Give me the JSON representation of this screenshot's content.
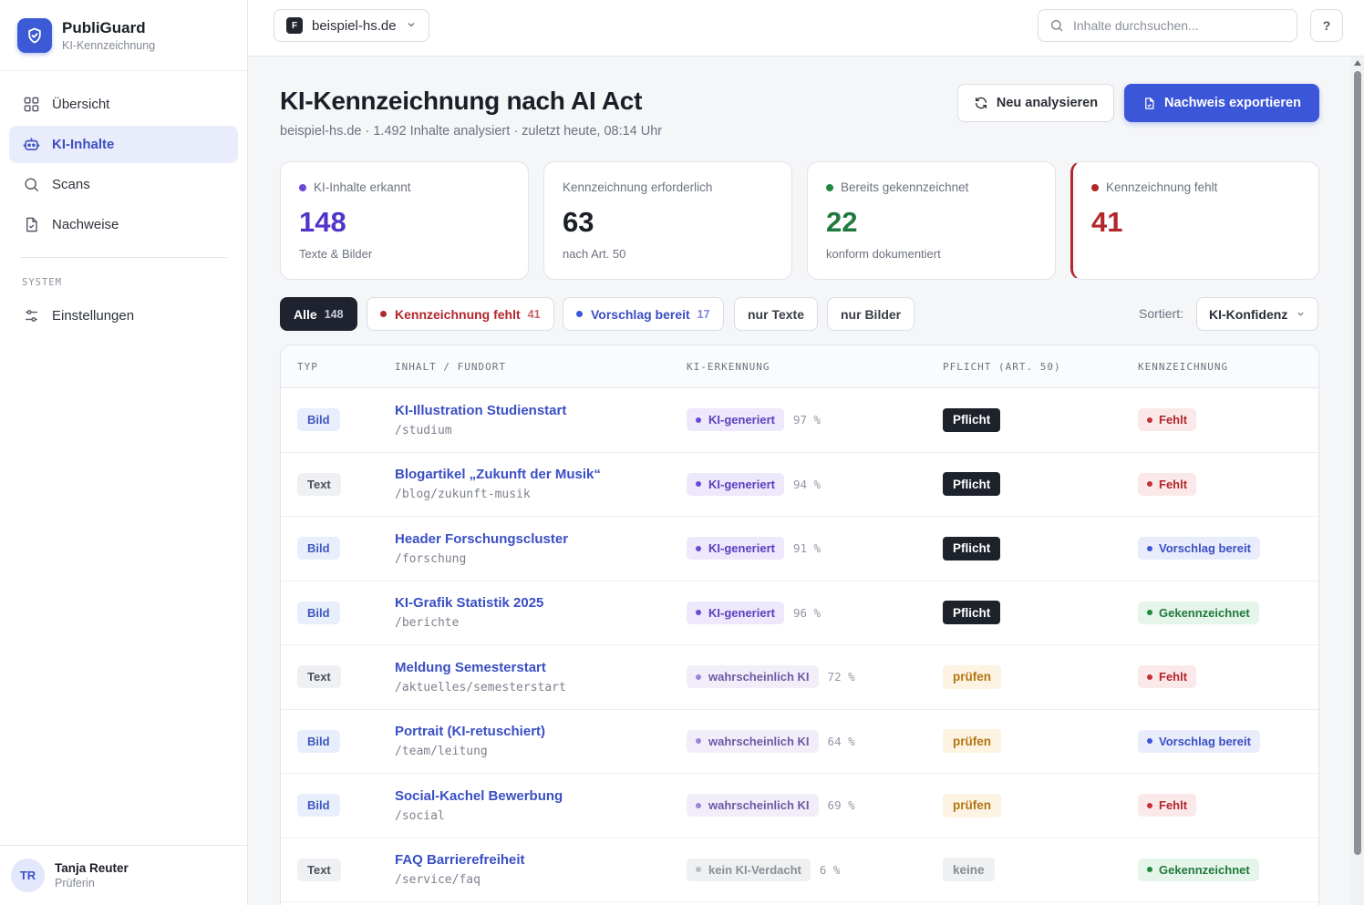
{
  "brand": {
    "name": "PubliGuard",
    "subtitle": "KI-Kennzeichnung"
  },
  "nav": {
    "items": [
      {
        "label": "Übersicht",
        "icon": "grid-icon",
        "active": false
      },
      {
        "label": "KI-Inhalte",
        "icon": "robot-icon",
        "active": true
      },
      {
        "label": "Scans",
        "icon": "search-icon",
        "active": false
      },
      {
        "label": "Nachweise",
        "icon": "document-check-icon",
        "active": false
      }
    ],
    "section_label": "SYSTEM",
    "system_items": [
      {
        "label": "Einstellungen",
        "icon": "sliders-icon"
      }
    ]
  },
  "user": {
    "initials": "TR",
    "name": "Tanja Reuter",
    "role": "Prüferin"
  },
  "topbar": {
    "site_favicon": "F",
    "site": "beispiel-hs.de",
    "search_placeholder": "Inhalte durchsuchen...",
    "help_label": "?"
  },
  "page": {
    "title": "KI-Kennzeichnung nach AI Act",
    "meta": "beispiel-hs.de · 1.492 Inhalte analysiert · zuletzt heute, 08:14 Uhr",
    "reanalyze_label": "Neu analysieren",
    "export_label": "Nachweis exportieren"
  },
  "stats": [
    {
      "label": "KI-Inhalte erkannt",
      "value": "148",
      "sub": "Texte & Bilder",
      "dot_color": "#6a4ad3",
      "value_color": "#5235c8"
    },
    {
      "label": "Kennzeichnung erforderlich",
      "value": "63",
      "sub": "nach Art. 50",
      "dot_color": "",
      "value_color": "#1b1e27"
    },
    {
      "label": "Bereits gekennzeichnet",
      "value": "22",
      "sub": "konform dokumentiert",
      "dot_color": "#22883f",
      "value_color": "#1f7a3c"
    },
    {
      "label": "Kennzeichnung fehlt",
      "value": "41",
      "sub": "",
      "dot_color": "#b3262c",
      "value_color": "#b3262c"
    }
  ],
  "filters": {
    "chips": [
      {
        "label": "Alle",
        "count": "148",
        "active": true,
        "dot_color": "",
        "color": "#ffffff",
        "count_color": "#c9ccd6"
      },
      {
        "label": "Kennzeichnung fehlt",
        "count": "41",
        "active": false,
        "dot_color": "#b3262c",
        "color": "#b3262c",
        "count_color": "#c9656a"
      },
      {
        "label": "Vorschlag bereit",
        "count": "17",
        "active": false,
        "dot_color": "#3c56d9",
        "color": "#3a4fc4",
        "count_color": "#7c89d9"
      },
      {
        "label": "nur Texte",
        "count": "",
        "active": false,
        "dot_color": "",
        "color": "#3a3e48",
        "count_color": ""
      },
      {
        "label": "nur Bilder",
        "count": "",
        "active": false,
        "dot_color": "",
        "color": "#3a3e48",
        "count_color": ""
      }
    ],
    "sort_label": "Sortiert:",
    "sort_value": "KI-Konfidenz"
  },
  "table": {
    "headers": [
      "TYP",
      "INHALT / FUNDORT",
      "KI-ERKENNUNG",
      "PFLICHT (ART. 50)",
      "KENNZEICHNUNG"
    ],
    "rows": [
      {
        "type": "Bild",
        "title": "KI-Illustration Studienstart",
        "path": "/studium",
        "ki": "KI-generiert",
        "ki_class": "ki-gen",
        "conf": "97 %",
        "pflicht": "Pflicht",
        "status": "Fehlt",
        "status_class": "st-Fehlt"
      },
      {
        "type": "Text",
        "title": "Blogartikel „Zukunft der Musik“",
        "path": "/blog/zukunft-musik",
        "ki": "KI-generiert",
        "ki_class": "ki-gen",
        "conf": "94 %",
        "pflicht": "Pflicht",
        "status": "Fehlt",
        "status_class": "st-Fehlt"
      },
      {
        "type": "Bild",
        "title": "Header Forschungscluster",
        "path": "/forschung",
        "ki": "KI-generiert",
        "ki_class": "ki-gen",
        "conf": "91 %",
        "pflicht": "Pflicht",
        "status": "Vorschlag bereit",
        "status_class": "st-Vorschlag"
      },
      {
        "type": "Bild",
        "title": "KI-Grafik Statistik 2025",
        "path": "/berichte",
        "ki": "KI-generiert",
        "ki_class": "ki-gen",
        "conf": "96 %",
        "pflicht": "Pflicht",
        "status": "Gekennzeichnet",
        "status_class": "st-Gekennzeichnet"
      },
      {
        "type": "Text",
        "title": "Meldung Semesterstart",
        "path": "/aktuelles/semesterstart",
        "ki": "wahrscheinlich KI",
        "ki_class": "ki-prob",
        "conf": "72 %",
        "pflicht": "prüfen",
        "status": "Fehlt",
        "status_class": "st-Fehlt"
      },
      {
        "type": "Bild",
        "title": "Portrait (KI-retuschiert)",
        "path": "/team/leitung",
        "ki": "wahrscheinlich KI",
        "ki_class": "ki-prob",
        "conf": "64 %",
        "pflicht": "prüfen",
        "status": "Vorschlag bereit",
        "status_class": "st-Vorschlag"
      },
      {
        "type": "Bild",
        "title": "Social-Kachel Bewerbung",
        "path": "/social",
        "ki": "wahrscheinlich KI",
        "ki_class": "ki-prob",
        "conf": "69 %",
        "pflicht": "prüfen",
        "status": "Fehlt",
        "status_class": "st-Fehlt"
      },
      {
        "type": "Text",
        "title": "FAQ Barrierefreiheit",
        "path": "/service/faq",
        "ki": "kein KI-Verdacht",
        "ki_class": "ki-none",
        "conf": "6 %",
        "pflicht": "keine",
        "status": "Gekennzeichnet",
        "status_class": "st-Gekennzeichnet"
      }
    ]
  }
}
